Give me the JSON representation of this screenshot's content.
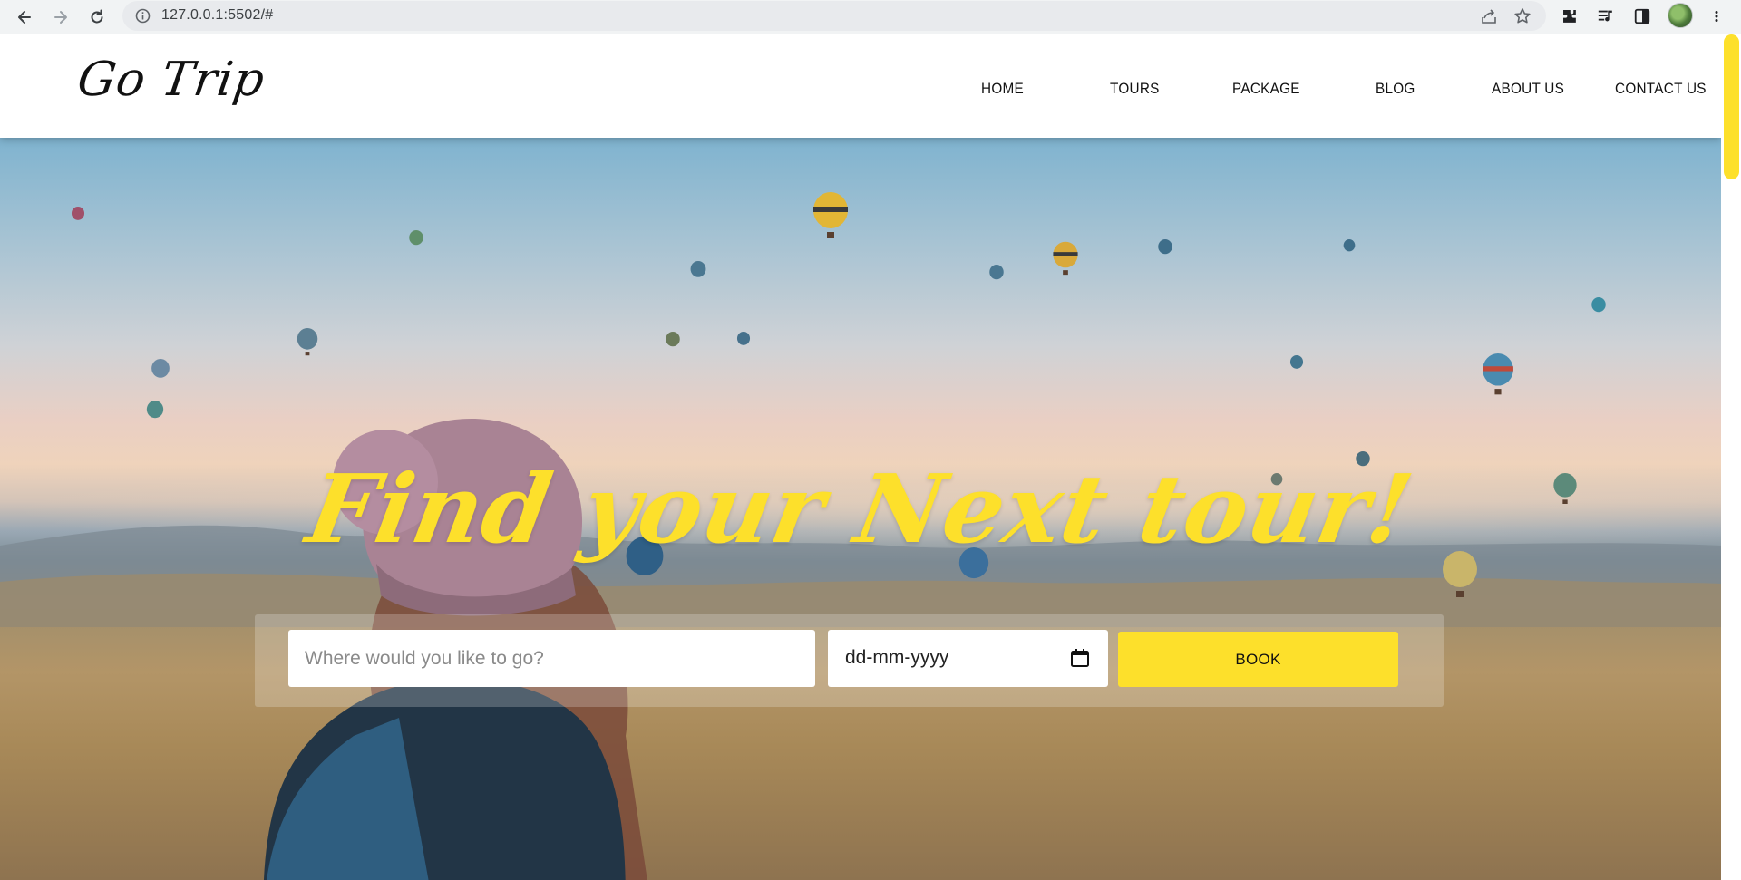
{
  "browser": {
    "url": "127.0.0.1:5502/#",
    "icons": [
      "back-icon",
      "forward-icon",
      "reload-icon",
      "info-icon",
      "share-icon",
      "star-icon",
      "extensions-icon",
      "media-icon",
      "sidepanel-icon",
      "avatar",
      "menu-icon"
    ]
  },
  "site": {
    "logo": "Go Trip",
    "nav": [
      "HOME",
      "TOURS",
      "PACKAGE",
      "BLOG",
      "ABOUT US",
      "CONTACT US"
    ]
  },
  "hero": {
    "title": "Find your Next tour!",
    "destination_placeholder": "Where would you like to go?",
    "destination_value": "",
    "date_value": "dd-mm-yyyy",
    "book_label": "BOOK"
  },
  "colors": {
    "accent": "#fde02b",
    "header_bg": "#ffffff",
    "text": "#111111"
  }
}
